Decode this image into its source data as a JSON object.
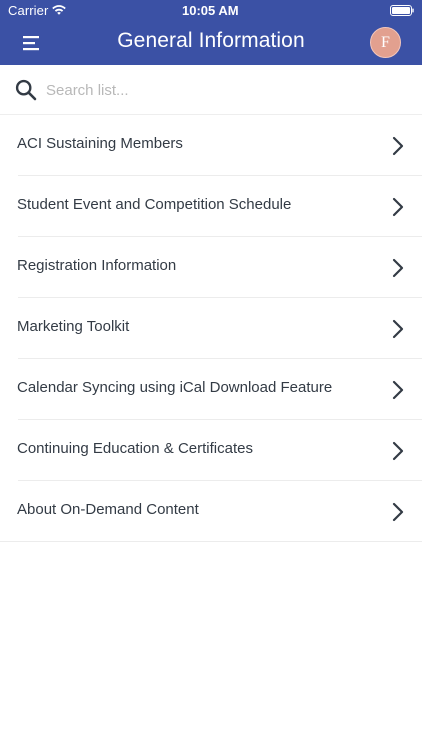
{
  "status_bar": {
    "carrier": "Carrier",
    "time": "10:05 AM",
    "wifi_icon": "wifi-icon",
    "battery_icon": "battery-icon"
  },
  "header": {
    "title": "General Information",
    "menu_icon": "hamburger-menu-icon",
    "avatar_initial": "F",
    "background_color": "#3b51a5",
    "avatar_color": "#e2a08f"
  },
  "search": {
    "placeholder": "Search list...",
    "value": "",
    "icon": "search-icon"
  },
  "list": {
    "items": [
      {
        "label": "ACI Sustaining Members"
      },
      {
        "label": "Student Event and Competition Schedule"
      },
      {
        "label": "Registration Information"
      },
      {
        "label": "Marketing Toolkit"
      },
      {
        "label": "Calendar Syncing using iCal Download Feature"
      },
      {
        "label": "Continuing Education & Certificates"
      },
      {
        "label": "About On-Demand Content"
      }
    ],
    "chevron_icon": "chevron-right-icon"
  }
}
